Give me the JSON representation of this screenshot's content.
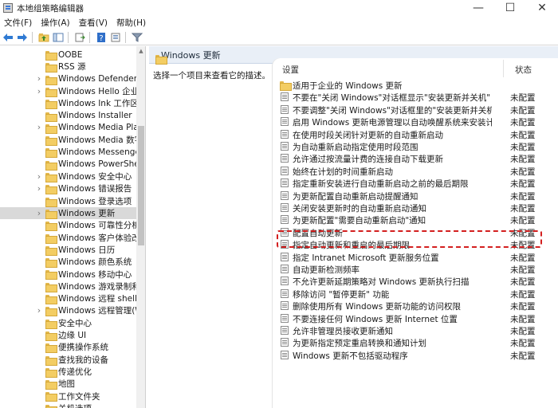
{
  "window": {
    "title": "本地组策略编辑器",
    "minimize_glyph": "—",
    "maximize_glyph": "☐",
    "close_glyph": "✕"
  },
  "menubar": {
    "file": "文件(F)",
    "action": "操作(A)",
    "view": "查看(V)",
    "help": "帮助(H)"
  },
  "toolbar": {
    "icons": [
      "back-arrow-icon",
      "forward-arrow-icon",
      "folder-up-icon",
      "show-hide-tree-icon",
      "export-list-icon",
      "help-icon",
      "properties-icon",
      "filter-icon"
    ]
  },
  "tree": {
    "items": [
      {
        "label": "OOBE",
        "expandable": false,
        "selected": false
      },
      {
        "label": "RSS 源",
        "expandable": false,
        "selected": false
      },
      {
        "label": "Windows Defender Sm",
        "expandable": true,
        "selected": false
      },
      {
        "label": "Windows Hello 企业版",
        "expandable": true,
        "selected": false
      },
      {
        "label": "Windows Ink 工作区",
        "expandable": false,
        "selected": false
      },
      {
        "label": "Windows Installer",
        "expandable": false,
        "selected": false
      },
      {
        "label": "Windows Media Playe",
        "expandable": true,
        "selected": false
      },
      {
        "label": "Windows Media 数字",
        "expandable": false,
        "selected": false
      },
      {
        "label": "Windows Messenger",
        "expandable": false,
        "selected": false
      },
      {
        "label": "Windows PowerShell",
        "expandable": false,
        "selected": false
      },
      {
        "label": "Windows 安全中心",
        "expandable": true,
        "selected": false
      },
      {
        "label": "Windows 错误报告",
        "expandable": true,
        "selected": false
      },
      {
        "label": "Windows 登录选项",
        "expandable": false,
        "selected": false
      },
      {
        "label": "Windows 更新",
        "expandable": true,
        "selected": true
      },
      {
        "label": "Windows 可靠性分析",
        "expandable": false,
        "selected": false
      },
      {
        "label": "Windows 客户体验改善",
        "expandable": false,
        "selected": false
      },
      {
        "label": "Windows 日历",
        "expandable": false,
        "selected": false
      },
      {
        "label": "Windows 颜色系统",
        "expandable": false,
        "selected": false
      },
      {
        "label": "Windows 移动中心",
        "expandable": false,
        "selected": false
      },
      {
        "label": "Windows 游戏录制和广",
        "expandable": false,
        "selected": false
      },
      {
        "label": "Windows 远程 shell",
        "expandable": false,
        "selected": false
      },
      {
        "label": "Windows 远程管理(Wi",
        "expandable": true,
        "selected": false
      },
      {
        "label": "安全中心",
        "expandable": false,
        "selected": false
      },
      {
        "label": "边缘 UI",
        "expandable": false,
        "selected": false
      },
      {
        "label": "便携操作系统",
        "expandable": false,
        "selected": false
      },
      {
        "label": "查找我的设备",
        "expandable": false,
        "selected": false
      },
      {
        "label": "传递优化",
        "expandable": false,
        "selected": false
      },
      {
        "label": "地图",
        "expandable": false,
        "selected": false
      },
      {
        "label": "工作文件夹",
        "expandable": false,
        "selected": false
      },
      {
        "label": "关机选项",
        "expandable": false,
        "selected": false
      }
    ]
  },
  "right_pane": {
    "title": "Windows 更新",
    "description": "选择一个项目来查看它的描述。",
    "columns": {
      "setting": "设置",
      "state": "状态"
    },
    "rows": [
      {
        "text": "适用于企业的 Windows 更新",
        "state": "",
        "type": "folder"
      },
      {
        "text": "不要在\"关闭 Windows\"对话框显示\"安装更新并关机\"",
        "state": "未配置",
        "type": "policy"
      },
      {
        "text": "不要调整\"关闭 Windows\"对话框里的\"安装更新并关机\"的默...",
        "state": "未配置",
        "type": "policy"
      },
      {
        "text": "启用 Windows 更新电源管理以自动唤醒系统来安装计划的...",
        "state": "未配置",
        "type": "policy"
      },
      {
        "text": "在使用时段关闭针对更新的自动重新启动",
        "state": "未配置",
        "type": "policy"
      },
      {
        "text": "为自动重新启动指定使用时段范围",
        "state": "未配置",
        "type": "policy"
      },
      {
        "text": "允许通过按流量计费的连接自动下载更新",
        "state": "未配置",
        "type": "policy"
      },
      {
        "text": "始终在计划的时间重新启动",
        "state": "未配置",
        "type": "policy"
      },
      {
        "text": "指定重新安装进行自动重新启动之前的最后期限",
        "state": "未配置",
        "type": "policy"
      },
      {
        "text": "为更新配置自动重新启动提醒通知",
        "state": "未配置",
        "type": "policy"
      },
      {
        "text": "关闭安装更新时的自动重新启动通知",
        "state": "未配置",
        "type": "policy"
      },
      {
        "text": "为更新配置\"需要自动重新启动\"通知",
        "state": "未配置",
        "type": "policy"
      },
      {
        "text": "配置自动更新",
        "state": "未配置",
        "type": "policy"
      },
      {
        "text": "指定自动更新和重启的最后期限",
        "state": "未配置",
        "type": "policy"
      },
      {
        "text": "指定 Intranet Microsoft 更新服务位置",
        "state": "未配置",
        "type": "policy"
      },
      {
        "text": "自动更新检测频率",
        "state": "未配置",
        "type": "policy"
      },
      {
        "text": "不允许更新延期策略对 Windows 更新执行扫描",
        "state": "未配置",
        "type": "policy"
      },
      {
        "text": "移除访问 \"暂停更新\" 功能",
        "state": "未配置",
        "type": "policy"
      },
      {
        "text": "删除使用所有 Windows 更新功能的访问权限",
        "state": "未配置",
        "type": "policy"
      },
      {
        "text": "不要连接任何 Windows 更新 Internet 位置",
        "state": "未配置",
        "type": "policy"
      },
      {
        "text": "允许非管理员接收更新通知",
        "state": "未配置",
        "type": "policy"
      },
      {
        "text": "为更新指定预定重启转换和通知计划",
        "state": "未配置",
        "type": "policy"
      },
      {
        "text": "Windows 更新不包括驱动程序",
        "state": "未配置",
        "type": "policy"
      }
    ]
  },
  "highlight_color": "#d31f1f",
  "selection_color": "#d9d9d9"
}
